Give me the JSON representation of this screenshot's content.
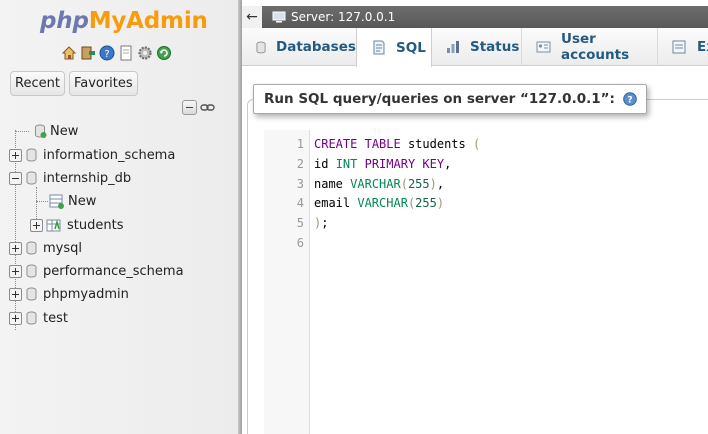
{
  "logo": {
    "php": "php",
    "myadmin": "MyAdmin"
  },
  "quick_icons": [
    "home-icon",
    "logout-icon",
    "docs-icon",
    "documentation-page-icon",
    "settings-icon",
    "reload-icon"
  ],
  "nav_buttons": {
    "recent": "Recent",
    "favorites": "Favorites"
  },
  "tree": {
    "new_root": "New",
    "databases": [
      {
        "name": "information_schema",
        "expanded": false
      },
      {
        "name": "internship_db",
        "expanded": true,
        "children": [
          {
            "name": "New"
          },
          {
            "name": "students"
          }
        ]
      },
      {
        "name": "mysql",
        "expanded": false
      },
      {
        "name": "performance_schema",
        "expanded": false
      },
      {
        "name": "phpmyadmin",
        "expanded": false
      },
      {
        "name": "test",
        "expanded": false
      }
    ]
  },
  "serverbar": {
    "back": "←",
    "label": "Server: 127.0.0.1"
  },
  "tabs": [
    {
      "label": "Databases",
      "icon": "database-icon",
      "active": false
    },
    {
      "label": "SQL",
      "icon": "sql-icon",
      "active": true
    },
    {
      "label": "Status",
      "icon": "status-icon",
      "active": false
    },
    {
      "label": "User accounts",
      "icon": "user-accounts-icon",
      "active": false
    },
    {
      "label": "Ex",
      "icon": "export-icon",
      "active": false
    }
  ],
  "sql_panel": {
    "legend": "Run SQL query/queries on server “127.0.0.1”:",
    "line_numbers": [
      "1",
      "2",
      "3",
      "4",
      "5",
      "6"
    ]
  },
  "sql_code": {
    "line1": {
      "kw1": "CREATE",
      "kw2": "TABLE",
      "name": "students",
      "paren": "("
    },
    "line2": {
      "col": "id",
      "type": "INT",
      "kw": "PRIMARY KEY",
      "comma": ","
    },
    "line3": {
      "col": "name",
      "type": "VARCHAR",
      "open": "(",
      "num": "255",
      "close": ")",
      "comma": ","
    },
    "line4": {
      "col": "email",
      "type": "VARCHAR",
      "open": "(",
      "num": "255",
      "close": ")"
    },
    "line5": {
      "close": ")",
      "semi": ";"
    }
  },
  "colors": {
    "logo_php": "#6c78af",
    "logo_myadmin": "#f89c0e",
    "tab_text": "#235a81",
    "serverbar": "#606060",
    "sql_keyword": "#770088",
    "sql_type": "#008855",
    "sql_number": "#116644"
  }
}
